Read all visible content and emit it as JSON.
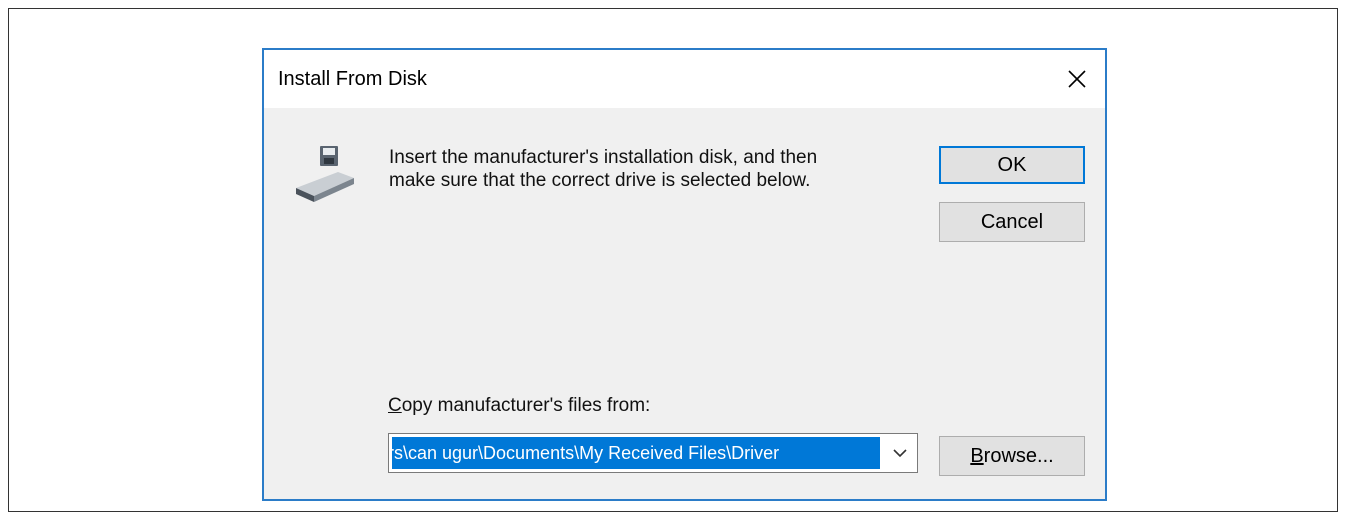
{
  "dialog": {
    "title": "Install From Disk",
    "close_icon": "close-icon",
    "disk_icon": "floppy-disk-drive-icon",
    "message_line1": "Insert the manufacturer's installation disk, and then",
    "message_line2": "make sure that the correct drive is selected below.",
    "ok_label": "OK",
    "cancel_label": "Cancel",
    "copy_label_mnemonic": "C",
    "copy_label_rest": "opy manufacturer's files from:",
    "path_value": "rs\\can ugur\\Documents\\My Received Files\\Driver",
    "dropdown_icon": "chevron-down-icon",
    "browse_mnemonic": "B",
    "browse_rest": "rowse...",
    "colors": {
      "accent": "#0078d7",
      "border": "#2b7cc8",
      "background": "#f0f0f0"
    }
  }
}
